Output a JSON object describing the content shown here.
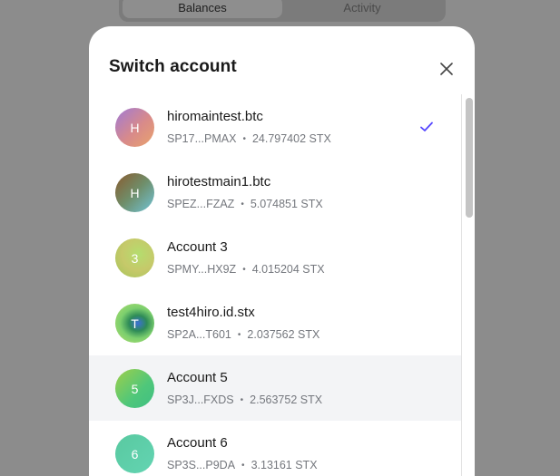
{
  "background": {
    "tabs": [
      {
        "label": "Balances",
        "active": true
      },
      {
        "label": "Activity",
        "active": false
      }
    ]
  },
  "modal": {
    "title": "Switch account",
    "accounts": [
      {
        "initial": "H",
        "name": "hiromaintest.btc",
        "address": "SP17...PMAX",
        "balance": "24.797402 STX",
        "selected": true
      },
      {
        "initial": "H",
        "name": "hirotestmain1.btc",
        "address": "SPEZ...FZAZ",
        "balance": "5.074851 STX",
        "selected": false
      },
      {
        "initial": "3",
        "name": "Account 3",
        "address": "SPMY...HX9Z",
        "balance": "4.015204 STX",
        "selected": false
      },
      {
        "initial": "T",
        "name": "test4hiro.id.stx",
        "address": "SP2A...T601",
        "balance": "2.037562 STX",
        "selected": false
      },
      {
        "initial": "5",
        "name": "Account 5",
        "address": "SP3J...FXDS",
        "balance": "2.563752 STX",
        "selected": false
      },
      {
        "initial": "6",
        "name": "Account 6",
        "address": "SP3S...P9DA",
        "balance": "3.13161 STX",
        "selected": false
      }
    ],
    "separator": "•"
  },
  "colors": {
    "accent": "#5546ff",
    "overlay": "#8c8c8c",
    "hover_row": "#f3f4f6"
  },
  "icons": {
    "close": "close-icon",
    "check": "checkmark-icon"
  }
}
